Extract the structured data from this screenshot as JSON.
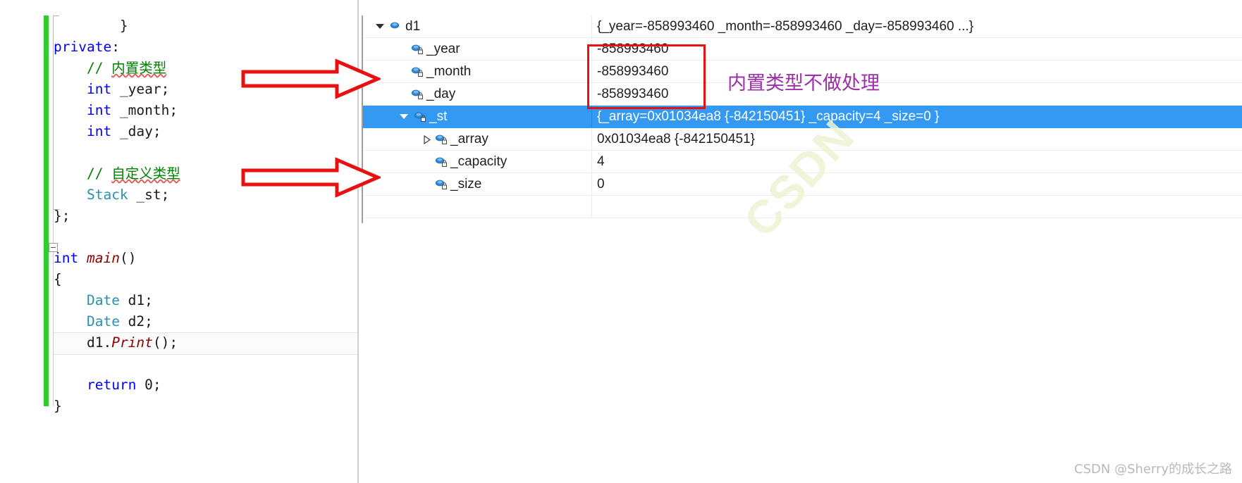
{
  "editor": {
    "lines": [
      {
        "indent": 8,
        "tokens": [
          {
            "t": "}",
            "c": "pun"
          }
        ]
      },
      {
        "indent": 0,
        "tokens": [
          {
            "t": "private",
            "c": "kw"
          },
          {
            "t": ":",
            "c": "pun"
          }
        ]
      },
      {
        "indent": 4,
        "tokens": [
          {
            "t": "// ",
            "c": "cmt"
          },
          {
            "t": "内置类型",
            "c": "cmt squiggle"
          }
        ]
      },
      {
        "indent": 4,
        "tokens": [
          {
            "t": "int",
            "c": "kw"
          },
          {
            "t": " _year;",
            "c": "pun"
          }
        ]
      },
      {
        "indent": 4,
        "tokens": [
          {
            "t": "int",
            "c": "kw"
          },
          {
            "t": " _month;",
            "c": "pun"
          }
        ]
      },
      {
        "indent": 4,
        "tokens": [
          {
            "t": "int",
            "c": "kw"
          },
          {
            "t": " _day;",
            "c": "pun"
          }
        ]
      },
      {
        "indent": 0,
        "tokens": []
      },
      {
        "indent": 4,
        "tokens": [
          {
            "t": "// ",
            "c": "cmt"
          },
          {
            "t": "自定义类型",
            "c": "cmt squiggle"
          }
        ]
      },
      {
        "indent": 4,
        "tokens": [
          {
            "t": "Stack",
            "c": "typ"
          },
          {
            "t": " _st;",
            "c": "pun"
          }
        ]
      },
      {
        "indent": 0,
        "tokens": [
          {
            "t": "};",
            "c": "pun"
          }
        ]
      },
      {
        "indent": 0,
        "tokens": []
      },
      {
        "indent": 0,
        "tokens": [
          {
            "t": "int",
            "c": "kw"
          },
          {
            "t": " ",
            "c": "pun"
          },
          {
            "t": "main",
            "c": "fn"
          },
          {
            "t": "()",
            "c": "pun"
          }
        ]
      },
      {
        "indent": 0,
        "tokens": [
          {
            "t": "{",
            "c": "pun"
          }
        ]
      },
      {
        "indent": 4,
        "tokens": [
          {
            "t": "Date",
            "c": "typ"
          },
          {
            "t": " d1;",
            "c": "pun"
          }
        ]
      },
      {
        "indent": 4,
        "tokens": [
          {
            "t": "Date",
            "c": "typ"
          },
          {
            "t": " d2;",
            "c": "pun"
          }
        ]
      },
      {
        "indent": 4,
        "tokens": [
          {
            "t": "d1.",
            "c": "pun"
          },
          {
            "t": "Print",
            "c": "fn"
          },
          {
            "t": "();",
            "c": "pun"
          }
        ]
      },
      {
        "indent": 0,
        "tokens": []
      },
      {
        "indent": 4,
        "tokens": [
          {
            "t": "return",
            "c": "kw"
          },
          {
            "t": " ",
            "c": "pun"
          },
          {
            "t": "0",
            "c": "num"
          },
          {
            "t": ";",
            "c": "pun"
          }
        ]
      },
      {
        "indent": 0,
        "tokens": [
          {
            "t": "}",
            "c": "pun"
          }
        ]
      }
    ],
    "current_line_index": 15
  },
  "watch": {
    "rows": [
      {
        "name": "d1",
        "value": "{_year=-858993460 _month=-858993460 _day=-858993460 ...}",
        "depth": 0,
        "expander": "expanded",
        "icon": "object-bullet-icon",
        "selected": false
      },
      {
        "name": "_year",
        "value": "-858993460",
        "depth": 1,
        "expander": "none",
        "icon": "private-field-icon",
        "selected": false
      },
      {
        "name": "_month",
        "value": "-858993460",
        "depth": 1,
        "expander": "none",
        "icon": "private-field-icon",
        "selected": false
      },
      {
        "name": "_day",
        "value": "-858993460",
        "depth": 1,
        "expander": "none",
        "icon": "private-field-icon",
        "selected": false
      },
      {
        "name": "_st",
        "value": "{_array=0x01034ea8 {-842150451} _capacity=4 _size=0 }",
        "depth": 1,
        "expander": "expanded",
        "icon": "private-field-icon",
        "selected": true
      },
      {
        "name": "_array",
        "value": "0x01034ea8 {-842150451}",
        "depth": 2,
        "expander": "collapsed",
        "icon": "private-field-icon",
        "selected": false
      },
      {
        "name": "_capacity",
        "value": "4",
        "depth": 2,
        "expander": "none",
        "icon": "private-field-icon",
        "selected": false
      },
      {
        "name": "_size",
        "value": "0",
        "depth": 2,
        "expander": "none",
        "icon": "private-field-icon",
        "selected": false
      },
      {
        "name": "",
        "value": "",
        "depth": 0,
        "expander": "none",
        "icon": "none",
        "selected": false
      }
    ]
  },
  "annotations": {
    "note_builtin_types": "内置类型不做处理",
    "highlight_color": "#e81010",
    "note_color": "#9b30a8",
    "arrow_color": "#e81010",
    "arrows": [
      {
        "name": "arrow-to-builtin-fields"
      },
      {
        "name": "arrow-to-custom-field"
      }
    ]
  },
  "watermark": {
    "text": "CSDN",
    "footer": "CSDN @Sherry的成长之路"
  }
}
